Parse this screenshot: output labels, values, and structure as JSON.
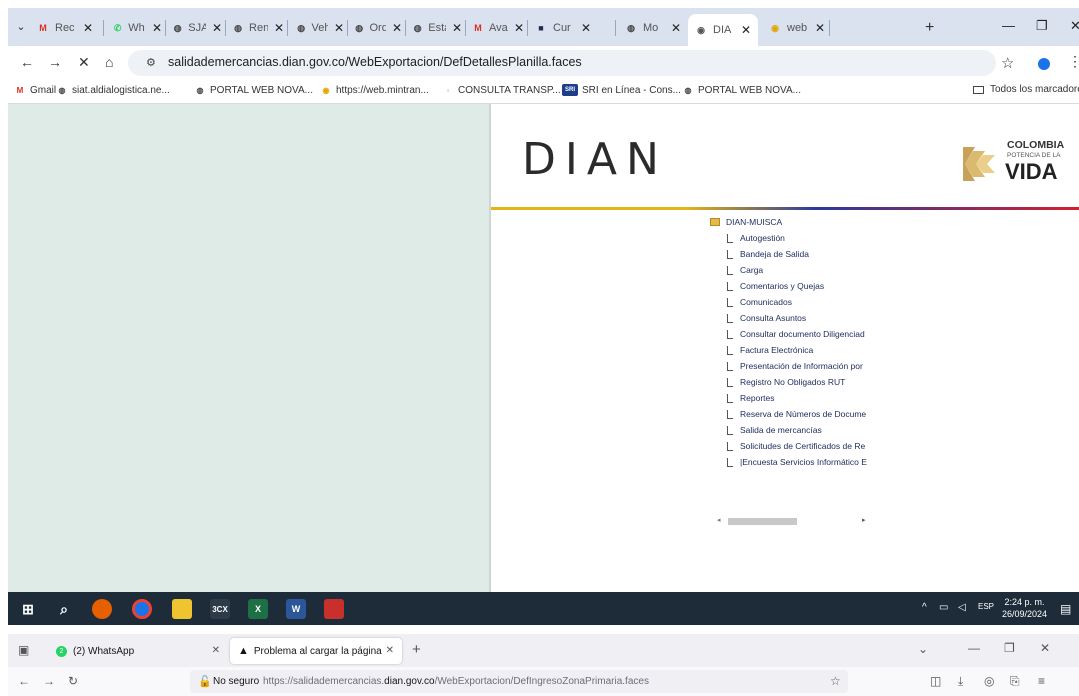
{
  "chrome": {
    "tabs": [
      {
        "label": "Rec",
        "favicon": "M",
        "favcolor": "#d93025"
      },
      {
        "label": "Wh",
        "favicon": "✆",
        "favcolor": "#25d366"
      },
      {
        "label": "SJA",
        "favicon": "◍",
        "favcolor": "#444444"
      },
      {
        "label": "Ren",
        "favicon": "◍",
        "favcolor": "#444444"
      },
      {
        "label": "Veh",
        "favicon": "◍",
        "favcolor": "#444444"
      },
      {
        "label": "Ord",
        "favicon": "◍",
        "favcolor": "#444444"
      },
      {
        "label": "Esta",
        "favicon": "◍",
        "favcolor": "#444444"
      },
      {
        "label": "Ava",
        "favicon": "M",
        "favcolor": "#d93025"
      },
      {
        "label": "Cur",
        "favicon": "■",
        "favcolor": "#1f2d4d"
      },
      {
        "label": "Mo",
        "favicon": "◍",
        "favcolor": "#444444"
      },
      {
        "label": "DIA",
        "favicon": "◉",
        "favcolor": "#555555"
      },
      {
        "label": "web",
        "favicon": "◉",
        "favcolor": "#e0a800"
      }
    ],
    "tab_close": "✕",
    "new_tab": "+",
    "url": "salidademercancias.dian.gov.co/WebExportacion/DefDetallesPlanilla.faces",
    "bookmarks": [
      {
        "label": "Gmail",
        "icon": "M",
        "color": "#d93025"
      },
      {
        "label": "siat.aldialogistica.ne...",
        "icon": "◍",
        "color": "#444444"
      },
      {
        "label": "PORTAL WEB NOVA...",
        "icon": "◍",
        "color": "#444444"
      },
      {
        "label": "https://web.mintran...",
        "icon": "◉",
        "color": "#e0a800"
      },
      {
        "label": "CONSULTA TRANSP...",
        "icon": "◦",
        "color": "#999999"
      },
      {
        "label": "SRI en Línea - Cons...",
        "icon": "SRI",
        "color": "#1b3f8b"
      },
      {
        "label": "PORTAL WEB NOVA...",
        "icon": "◍",
        "color": "#444444"
      }
    ],
    "all_bookmarks": "Todos los marcadores"
  },
  "dian": {
    "logo": "DIAN",
    "colombia_line1": "COLOMBIA",
    "colombia_line2": "POTENCIA DE LA",
    "colombia_line3": "VIDA",
    "tree_root": "DIAN-MUISCA",
    "tree_items": [
      "Autogestión",
      "Bandeja de Salida",
      "Carga",
      "Comentarios y Quejas",
      "Comunicados",
      "Consulta Asuntos",
      "Consultar documento Diligenciad",
      "Factura Electrónica",
      "Presentación de Información por",
      "Registro No Obligados RUT",
      "Reportes",
      "Reserva de Números de Docume",
      "Salida de mercancías",
      "Solicitudes de Certificados de Re",
      "|Encuesta Servicios Informático E"
    ],
    "accent_colors": [
      "#e7b417",
      "#2b3a9b",
      "#d61f2c"
    ]
  },
  "taskbar": {
    "lang": "ESP",
    "time": "2:24 p. m.",
    "date": "26/09/2024"
  },
  "firefox": {
    "tab1": "(2) WhatsApp",
    "tab1_badge": "2",
    "tab2": "Problema al cargar la página",
    "no_seguro": "No seguro",
    "url_prefix": "https://salidademercancias.",
    "url_domain": "dian.gov.co",
    "url_path": "/WebExportacion/DefIngresoZonaPrimaria.faces"
  }
}
